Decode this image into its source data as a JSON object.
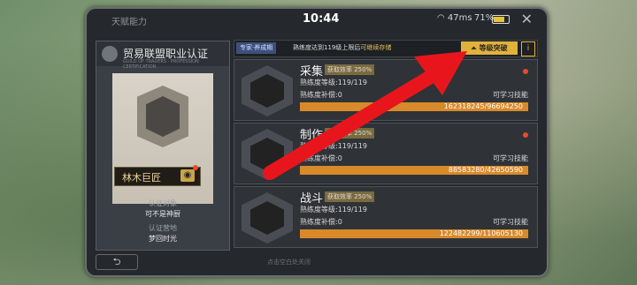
{
  "status": {
    "title": "天赋能力",
    "time": "10:44",
    "network": "47ms",
    "battery": "71%"
  },
  "cert": {
    "title": "贸易联盟职业认证",
    "subtitle": "GUILD OF TRADERS · PROFESSION CERTIFICATION",
    "name": "林木巨匠",
    "target_label": "认证对象",
    "target_value": "可不是神厨",
    "place_label": "认证营地",
    "place_value": "梦回时光"
  },
  "topbar": {
    "tag": "专家·养成期",
    "notice_prefix": "熟练度达到119级上限后",
    "notice_suffix": "可继续存储",
    "breakthrough": "等级突破",
    "info": "i"
  },
  "skills": [
    {
      "name": "采集",
      "rate": "获取效率 250%",
      "level": "熟练度等级:119/119",
      "bonus": "熟练度补偿:0",
      "learn": "可学习技能",
      "progress": "162318245/96694250",
      "fill": 1.0
    },
    {
      "name": "制作",
      "rate": "获取效率 250%",
      "level": "熟练度等级:119/119",
      "bonus": "熟练度补偿:0",
      "learn": "可学习技能",
      "progress": "88583280/42650590",
      "fill": 1.0
    },
    {
      "name": "战斗",
      "rate": "获取效率 250%",
      "level": "熟练度等级:119/119",
      "bonus": "熟练度补偿:0",
      "learn": "可学习技能",
      "progress": "122482299/110605130",
      "fill": 1.0
    }
  ],
  "footer": {
    "back": "⮌",
    "hint": "点击空白处关闭"
  },
  "colors": {
    "accent": "#e1b23a",
    "progress": "#d88a2b",
    "arrow": "#e8161c"
  }
}
